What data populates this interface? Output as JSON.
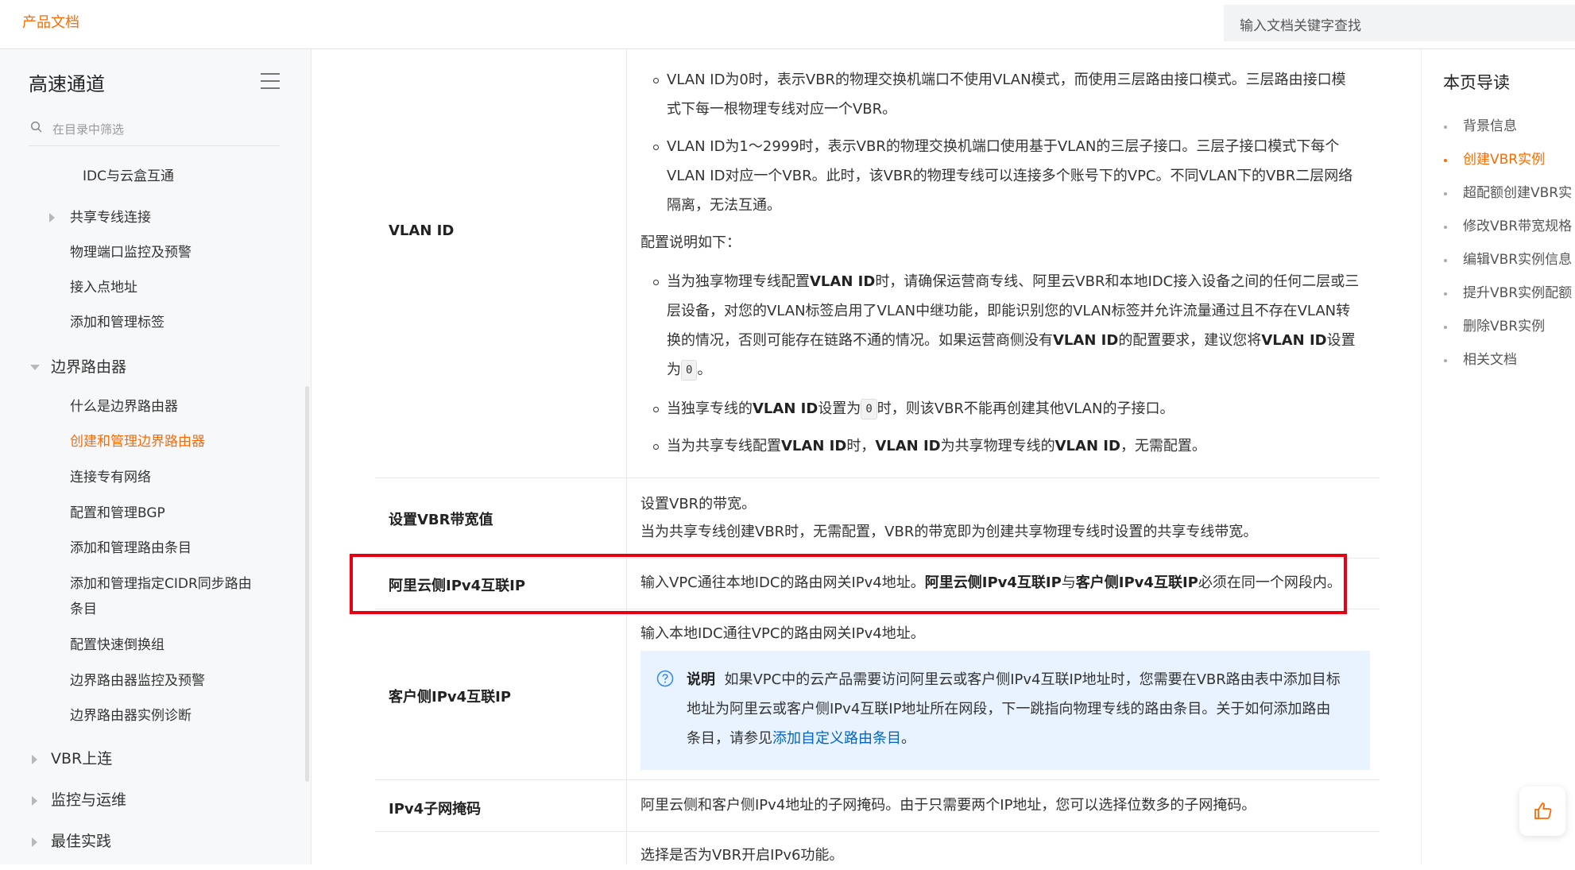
{
  "header": {
    "brand": "产品文档",
    "search_placeholder": "输入文档关键字查找"
  },
  "sidebar": {
    "title": "高速通道",
    "filter_placeholder": "在目录中筛选",
    "items": [
      {
        "label": "IDC与云盒互通"
      },
      {
        "label": "共享专线连接"
      },
      {
        "label": "物理端口监控及预警"
      },
      {
        "label": "接入点地址"
      },
      {
        "label": "添加和管理标签"
      },
      {
        "label": "边界路由器"
      },
      {
        "label": "什么是边界路由器"
      },
      {
        "label": "创建和管理边界路由器"
      },
      {
        "label": "连接专有网络"
      },
      {
        "label": "配置和管理BGP"
      },
      {
        "label": "添加和管理路由条目"
      },
      {
        "label": "添加和管理指定CIDR同步路由"
      },
      {
        "label": "条目"
      },
      {
        "label": "配置快速倒换组"
      },
      {
        "label": "边界路由器监控及预警"
      },
      {
        "label": "边界路由器实例诊断"
      },
      {
        "label": "VBR上连"
      },
      {
        "label": "监控与运维"
      },
      {
        "label": "最佳实践"
      }
    ]
  },
  "content": {
    "rows": [
      {
        "label": "VLAN ID",
        "lines": [
          "VLAN ID为0时，表示VBR的物理交换机端口不使用VLAN模式，而使用三层路由接口模式。三层路由接口模",
          "式下每一根物理专线对应一个VBR。",
          "VLAN ID为1～2999时，表示VBR的物理交换机端口使用基于VLAN的三层子接口。三层子接口模式下每个",
          "VLAN ID对应一个VBR。此时，该VBR的物理专线可以连接多个账号下的VPC。不同VLAN下的VBR二层网络",
          "隔离，无法互通。",
          "配置说明如下：",
          "当为独享物理专线配置",
          "VLAN ID",
          "时，请确保运营商专线、阿里云VBR和本地IDC接入设备之间的任何二层或三",
          "层设备，对您的VLAN标签启用了VLAN中继功能，即能识别您的VLAN标签并允许流量通过且不存在VLAN转",
          "换的情况，否则可能存在链路不通的情况。如果运营商侧没有",
          "VLAN ID",
          "的配置要求，建议您将",
          "VLAN ID",
          "设置",
          "为",
          "0",
          "。",
          "当独享专线的",
          "VLAN ID",
          "设置为",
          "0",
          "时，则该VBR不能再创建其他VLAN的子接口。",
          "当为共享专线配置",
          "VLAN ID",
          "时，",
          "VLAN ID",
          "为共享物理专线的",
          "VLAN ID",
          "，无需配置。"
        ]
      },
      {
        "label": "设置VBR带宽值",
        "lines": [
          "设置VBR的带宽。",
          "当为共享专线创建VBR时，无需配置，VBR的带宽即为创建共享物理专线时设置的共享专线带宽。"
        ]
      },
      {
        "label": "阿里云侧IPv4互联IP",
        "lines": [
          "输入VPC通往本地IDC的路由网关IPv4地址。",
          "阿里云侧IPv4互联IP",
          "与",
          "客户侧IPv4互联IP",
          "必须在同一个网段内。"
        ]
      },
      {
        "label": "客户侧IPv4互联IP",
        "lines": [
          "输入本地IDC通往VPC的路由网关IPv4地址。"
        ],
        "note": {
          "title": "说明",
          "line1": "如果VPC中的云产品需要访问阿里云或客户侧IPv4互联IP地址时，您需要在VBR路由表中添加目标",
          "line2": "地址为阿里云或客户侧IPv4互联IP地址所在网段，下一跳指向物理专线的路由条目。关于如何添加路由",
          "line3_prefix": "条目，请参见",
          "line3_link": "添加自定义路由条目",
          "line3_suffix": "。"
        }
      },
      {
        "label": "IPv4子网掩码",
        "lines": [
          "阿里云侧和客户侧IPv4地址的子网掩码。由于只需要两个IP地址，您可以选择位数多的子网掩码。"
        ]
      },
      {
        "label": "",
        "lines": [
          "选择是否为VBR开启IPv6功能。"
        ]
      }
    ]
  },
  "toc": {
    "title": "本页导读",
    "items": [
      {
        "label": "背景信息"
      },
      {
        "label": "创建VBR实例"
      },
      {
        "label": "超配额创建VBR实"
      },
      {
        "label": "修改VBR带宽规格"
      },
      {
        "label": "编辑VBR实例信息"
      },
      {
        "label": "提升VBR实例配额"
      },
      {
        "label": "删除VBR实例"
      },
      {
        "label": "相关文档"
      }
    ]
  },
  "colors": {
    "accent": "#ff6a00",
    "highlight_box": "#e60012",
    "note_bg": "#e9f3ff",
    "link": "#0064c8"
  }
}
